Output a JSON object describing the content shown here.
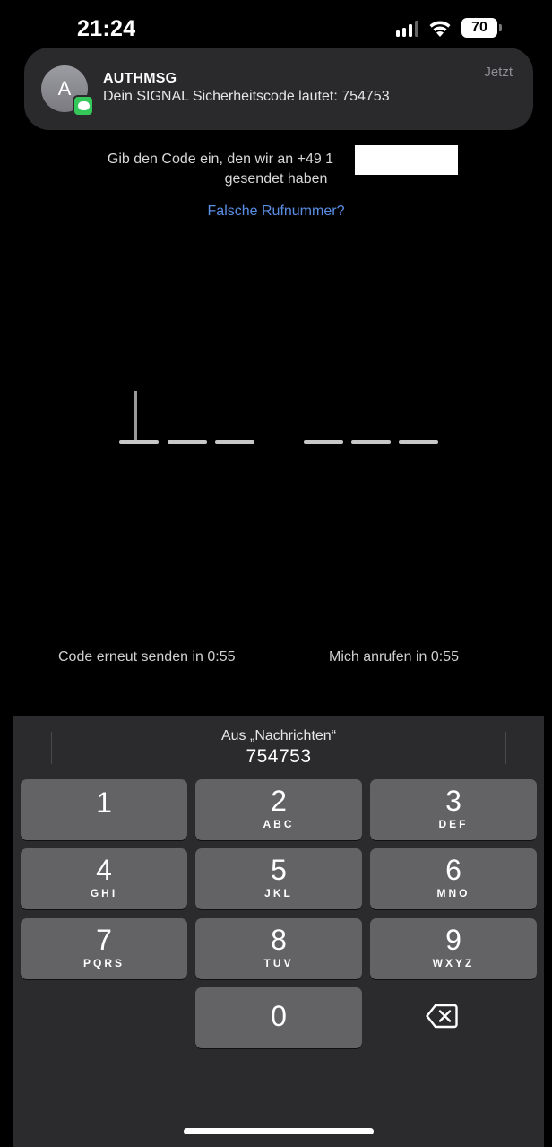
{
  "status_bar": {
    "time": "21:24",
    "battery": "70"
  },
  "notification": {
    "avatar_letter": "A",
    "sender": "AUTHMSG",
    "body": "Dein SIGNAL Sicherheitscode lautet: 754753",
    "time": "Jetzt"
  },
  "verify": {
    "instruction_line1": "Gib den Code ein, den wir an +49 1",
    "instruction_line2": "gesendet haben",
    "wrong_number_link": "Falsche Rufnummer?",
    "resend_label": "Code erneut senden in 0:55",
    "call_label": "Mich anrufen in 0:55"
  },
  "keyboard": {
    "suggestion_source": "Aus „Nachrichten“",
    "suggestion_code": "754753",
    "keys": [
      {
        "digit": "1",
        "letters": ""
      },
      {
        "digit": "2",
        "letters": "ABC"
      },
      {
        "digit": "3",
        "letters": "DEF"
      },
      {
        "digit": "4",
        "letters": "GHI"
      },
      {
        "digit": "5",
        "letters": "JKL"
      },
      {
        "digit": "6",
        "letters": "MNO"
      },
      {
        "digit": "7",
        "letters": "PQRS"
      },
      {
        "digit": "8",
        "letters": "TUV"
      },
      {
        "digit": "9",
        "letters": "WXYZ"
      },
      {
        "digit": "0",
        "letters": ""
      }
    ]
  },
  "icons": {
    "signal": "cellular-signal-icon",
    "wifi": "wifi-icon",
    "battery": "battery-icon",
    "messages": "messages-icon",
    "backspace": "backspace-icon"
  },
  "colors": {
    "link": "#5a8fe6",
    "messages_badge": "#35c759",
    "key": "#636366",
    "keyboard_bg": "#2b2b2d"
  }
}
